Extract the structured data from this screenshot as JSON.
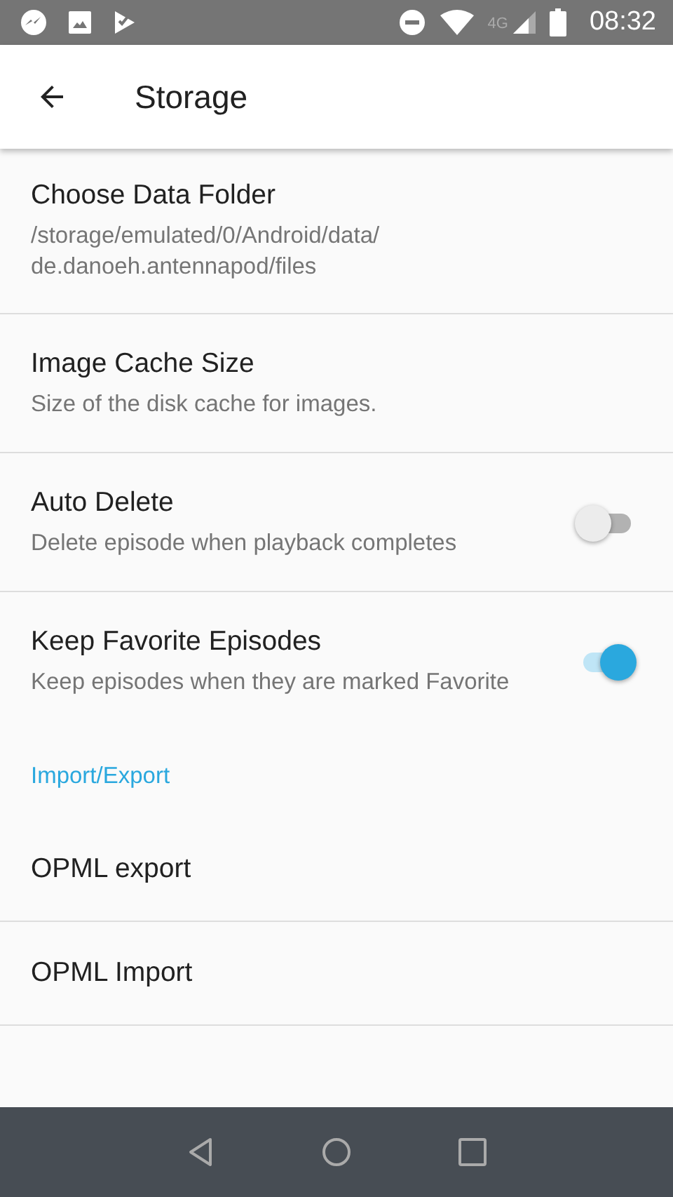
{
  "status_bar": {
    "time": "08:32",
    "network": "4G"
  },
  "toolbar": {
    "title": "Storage"
  },
  "preferences": [
    {
      "kind": "text",
      "title": "Choose Data Folder",
      "summary": "/storage/emulated/0/Android/data/\nde.danoeh.antennapod/files"
    },
    {
      "kind": "text",
      "title": "Image Cache Size",
      "summary": "Size of the disk cache for images."
    },
    {
      "kind": "switch",
      "title": "Auto Delete",
      "summary": "Delete episode when playback completes",
      "on": false
    },
    {
      "kind": "switch",
      "title": "Keep Favorite Episodes",
      "summary": "Keep episodes when they are marked Favorite",
      "on": true
    },
    {
      "kind": "category",
      "title": "Import/Export"
    },
    {
      "kind": "text",
      "title": "OPML export"
    },
    {
      "kind": "text",
      "title": "OPML Import"
    }
  ]
}
